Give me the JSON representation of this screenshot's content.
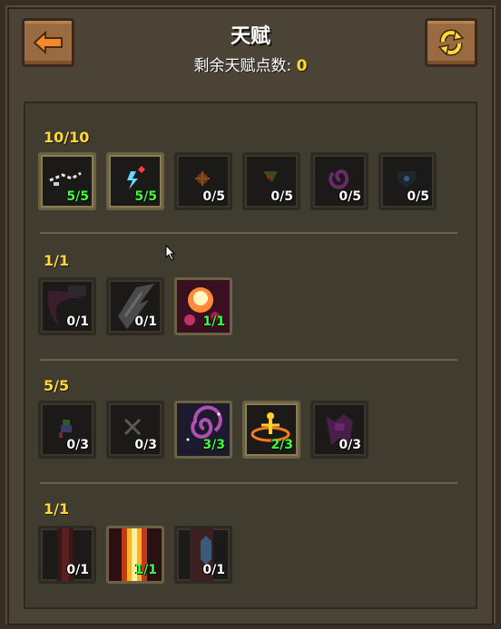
{
  "header": {
    "title": "天赋",
    "remaining_label": "剩余天赋点数: ",
    "remaining_value": "0"
  },
  "buttons": {
    "back_icon": "back-arrow-icon",
    "refresh_icon": "refresh-icon"
  },
  "groups": [
    {
      "label": "10/10",
      "talents": [
        {
          "level": "5/5",
          "active": true,
          "icon": "dash-icon"
        },
        {
          "level": "5/5",
          "active": true,
          "icon": "lightning-icon"
        },
        {
          "level": "0/5",
          "active": false,
          "icon": "flame-icon"
        },
        {
          "level": "0/5",
          "active": false,
          "icon": "leaf-icon"
        },
        {
          "level": "0/5",
          "active": false,
          "icon": "spiral-icon"
        },
        {
          "level": "0/5",
          "active": false,
          "icon": "shield-icon"
        }
      ]
    },
    {
      "label": "1/1",
      "talents": [
        {
          "level": "0/1",
          "active": false,
          "icon": "dark-claw-icon"
        },
        {
          "level": "0/1",
          "active": false,
          "icon": "slash-icon"
        },
        {
          "level": "1/1",
          "active": true,
          "icon": "explosion-icon"
        }
      ]
    },
    {
      "label": "5/5",
      "talents": [
        {
          "level": "0/3",
          "active": false,
          "icon": "figure-icon"
        },
        {
          "level": "0/3",
          "active": false,
          "icon": "crossed-blades-icon"
        },
        {
          "level": "3/3",
          "active": true,
          "icon": "vortex-icon"
        },
        {
          "level": "2/3",
          "active": true,
          "icon": "orbit-figure-icon"
        },
        {
          "level": "0/3",
          "active": false,
          "icon": "shadow-icon"
        }
      ]
    },
    {
      "label": "1/1",
      "talents": [
        {
          "level": "0/1",
          "active": false,
          "icon": "red-beam-icon"
        },
        {
          "level": "1/1",
          "active": true,
          "icon": "golden-beam-icon"
        },
        {
          "level": "0/1",
          "active": false,
          "icon": "crystal-beam-icon"
        }
      ]
    }
  ]
}
